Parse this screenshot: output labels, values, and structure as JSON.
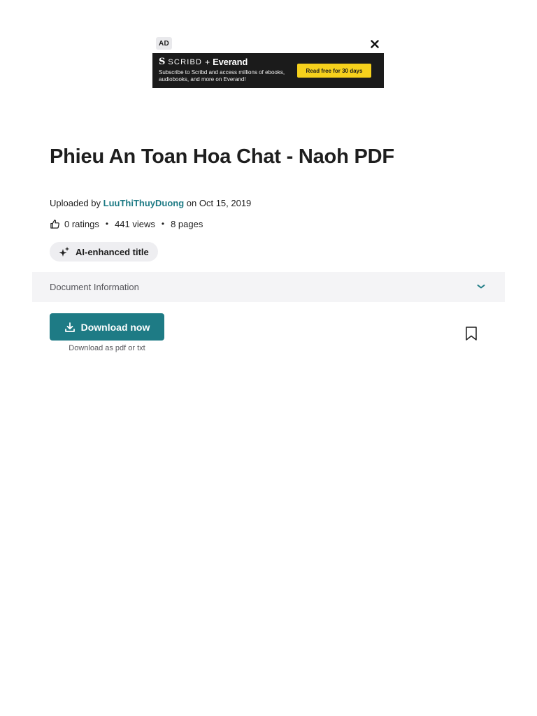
{
  "ad": {
    "label": "AD",
    "brand": {
      "mark": "S",
      "scribd": "SCRIBD",
      "plus": "+",
      "everand": "Everand"
    },
    "copy": "Subscribe to Scribd and access millions of ebooks, audiobooks, and more on Everand!",
    "cta": "Read free for 30 days",
    "cta_color": "#f6d11c",
    "background_color": "#1b1b1b"
  },
  "document": {
    "title": "Phieu An Toan Hoa Chat - Naoh PDF",
    "uploaded_by_prefix": "Uploaded by",
    "uploader": "LuuThiThuyDuong",
    "uploaded_on": "on Oct 15, 2019",
    "ratings": "0 ratings",
    "views": "441 views",
    "pages": "8 pages",
    "separator": "•",
    "ai_badge": "AI-enhanced title"
  },
  "doc_info": {
    "label": "Document Information"
  },
  "download": {
    "button_label": "Download now",
    "subtext": "Download as pdf or txt"
  },
  "colors": {
    "accent": "#1e7b85",
    "text": "#1e1e1e",
    "muted": "#57575c"
  }
}
